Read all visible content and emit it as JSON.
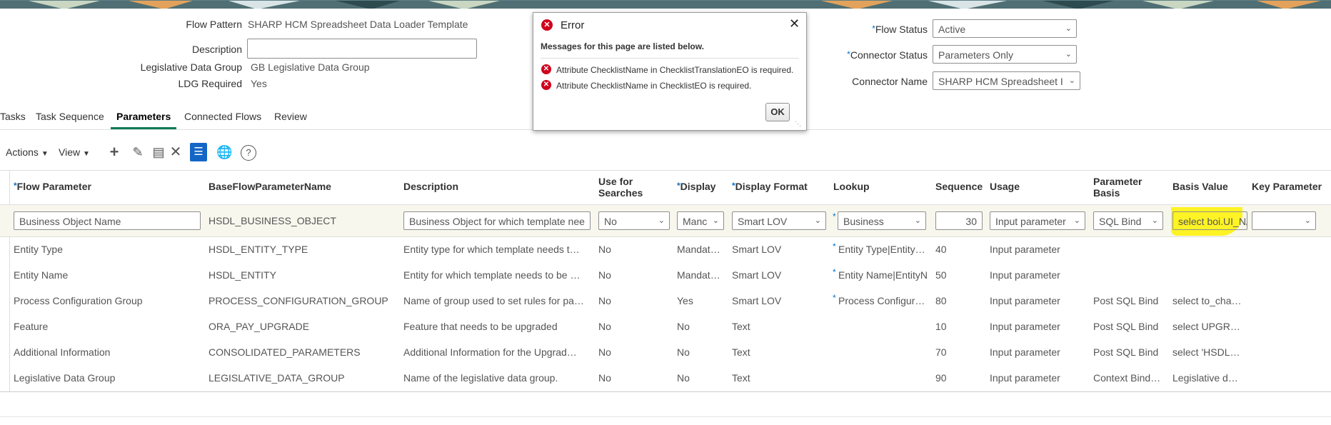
{
  "header": {
    "flow_pattern_label": "Flow Pattern",
    "flow_pattern_value": "SHARP HCM Spreadsheet Data Loader Template",
    "description_label": "Description",
    "description_value": "",
    "ldg_label": "Legislative Data Group",
    "ldg_value": "GB Legislative Data Group",
    "ldg_required_label": "LDG Required",
    "ldg_required_value": "Yes",
    "flow_status_label": "Flow Status",
    "flow_status_value": "Active",
    "connector_status_label": "Connector Status",
    "connector_status_value": "Parameters Only",
    "connector_name_label": "Connector Name",
    "connector_name_value": "SHARP HCM Spreadsheet I"
  },
  "tabs": [
    {
      "label": "Tasks"
    },
    {
      "label": "Task Sequence"
    },
    {
      "label": "Parameters"
    },
    {
      "label": "Connected Flows"
    },
    {
      "label": "Review"
    }
  ],
  "toolbar": {
    "actions_label": "Actions",
    "view_label": "View",
    "icons": [
      "add-icon",
      "edit-icon",
      "duplicate-icon",
      "delete-icon",
      "checklist-icon",
      "globe-icon",
      "help-icon"
    ]
  },
  "table": {
    "headers": {
      "flow_parameter": "Flow Parameter",
      "base_name": "BaseFlowParameterName",
      "description": "Description",
      "use_for_searches": "Use for Searches",
      "display": "Display",
      "display_format": "Display Format",
      "lookup": "Lookup",
      "sequence": "Sequence",
      "usage": "Usage",
      "parameter_basis": "Parameter Basis",
      "basis_value": "Basis Value",
      "key_parameter": "Key Parameter"
    },
    "edit_row": {
      "flow_parameter": "Business Object Name",
      "base_name": "HSDL_BUSINESS_OBJECT",
      "description": "Business Object for which template nee",
      "use_for_searches": "No",
      "display": "Manc",
      "display_format": "Smart LOV",
      "lookup": "Business",
      "sequence": "30",
      "usage": "Input parameter",
      "parameter_basis": "SQL Bind",
      "basis_value": "select boi.UI_NA",
      "key_parameter": ""
    },
    "rows": [
      {
        "flow_parameter": "Entity Type",
        "base_name": "HSDL_ENTITY_TYPE",
        "description": "Entity type for which template needs t…",
        "use_for_searches": "No",
        "display": "Mandat…",
        "display_format": "Smart LOV",
        "lookup": "Entity Type|EntityTyp",
        "lookup_req": "*",
        "sequence": "40",
        "usage": "Input parameter",
        "parameter_basis": "",
        "basis_value": ""
      },
      {
        "flow_parameter": "Entity Name",
        "base_name": "HSDL_ENTITY",
        "description": "Entity for which template needs to be …",
        "use_for_searches": "No",
        "display": "Mandat…",
        "display_format": "Smart LOV",
        "lookup": "Entity Name|EntityN",
        "lookup_req": "*",
        "sequence": "50",
        "usage": "Input parameter",
        "parameter_basis": "",
        "basis_value": ""
      },
      {
        "flow_parameter": "Process Configuration Group",
        "base_name": "PROCESS_CONFIGURATION_GROUP",
        "description": "Name of group used to set rules for pa…",
        "use_for_searches": "No",
        "display": "Yes",
        "display_format": "Smart LOV",
        "lookup": "Process Configuratic",
        "lookup_req": "*",
        "sequence": "80",
        "usage": "Input parameter",
        "parameter_basis": "Post SQL Bind",
        "basis_value": "select to_cha…"
      },
      {
        "flow_parameter": "Feature",
        "base_name": "ORA_PAY_UPGRADE",
        "description": "Feature that needs to be upgraded",
        "use_for_searches": "No",
        "display": "No",
        "display_format": "Text",
        "lookup": "",
        "lookup_req": "",
        "sequence": "10",
        "usage": "Input parameter",
        "parameter_basis": "Post SQL Bind",
        "basis_value": "select UPGRA…"
      },
      {
        "flow_parameter": "Additional Information",
        "base_name": "CONSOLIDATED_PARAMETERS",
        "description": "Additional Information for the Upgrad…",
        "use_for_searches": "No",
        "display": "No",
        "display_format": "Text",
        "lookup": "",
        "lookup_req": "",
        "sequence": "70",
        "usage": "Input parameter",
        "parameter_basis": "Post SQL Bind",
        "basis_value": "select 'HSDL_…"
      },
      {
        "flow_parameter": "Legislative Data Group",
        "base_name": "LEGISLATIVE_DATA_GROUP",
        "description": "Name of the legislative data group.",
        "use_for_searches": "No",
        "display": "No",
        "display_format": "Text",
        "lookup": "",
        "lookup_req": "",
        "sequence": "90",
        "usage": "Input parameter",
        "parameter_basis": "Context Bind…",
        "basis_value": "Legislative d…"
      }
    ]
  },
  "dialog": {
    "title": "Error",
    "subtitle": "Messages for this page are listed below.",
    "messages": [
      "Attribute ChecklistName in ChecklistTranslationEO is required.",
      "Attribute ChecklistName in ChecklistEO is required."
    ],
    "ok_label": "OK"
  },
  "colors": {
    "accent_tab": "#0d7a59",
    "error": "#d0021b",
    "required": "#0572ce",
    "highlight": "#fff200"
  }
}
